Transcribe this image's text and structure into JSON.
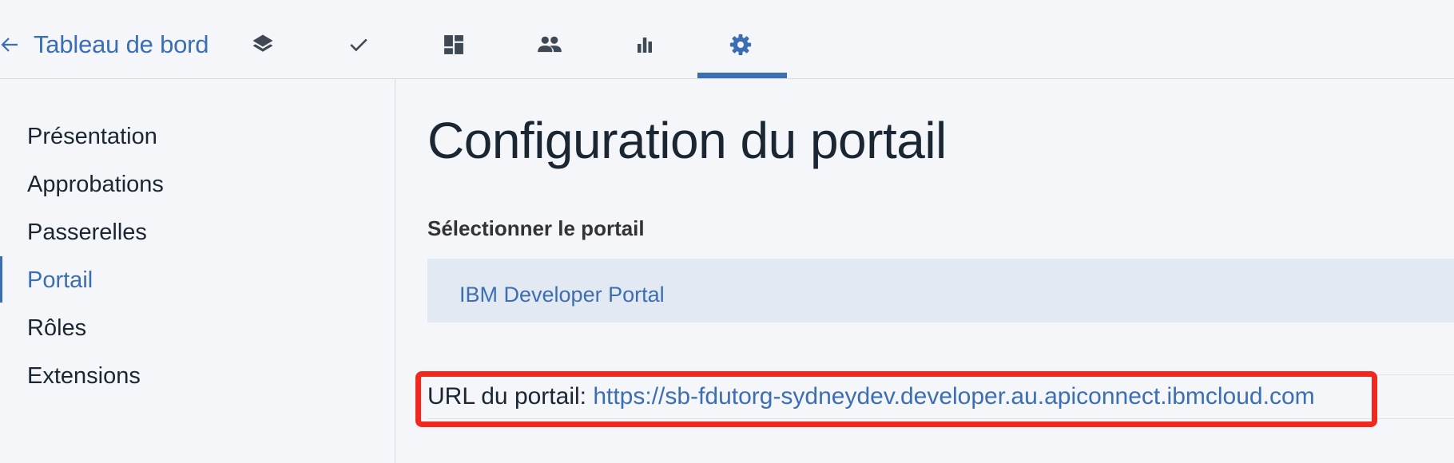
{
  "header": {
    "back_label": "Tableau de bord",
    "tabs": [
      {
        "icon": "layers-icon"
      },
      {
        "icon": "checkmark-icon"
      },
      {
        "icon": "dashboard-icon"
      },
      {
        "icon": "users-icon"
      },
      {
        "icon": "bar-chart-icon"
      },
      {
        "icon": "gear-icon",
        "active": true
      }
    ]
  },
  "sidebar": {
    "items": [
      {
        "label": "Présentation"
      },
      {
        "label": "Approbations"
      },
      {
        "label": "Passerelles"
      },
      {
        "label": "Portail",
        "active": true
      },
      {
        "label": "Rôles"
      },
      {
        "label": "Extensions"
      }
    ]
  },
  "main": {
    "title": "Configuration du portail",
    "select_label": "Sélectionner le portail",
    "selected_portal": "IBM Developer Portal",
    "url_prefix": "URL du portail: ",
    "url": "https://sb-fdutorg-sydneydev.developer.au.apiconnect.ibmcloud.com"
  },
  "colors": {
    "accent": "#3b6eb3",
    "highlight": "#f2281f",
    "background": "#f4f6fa"
  }
}
